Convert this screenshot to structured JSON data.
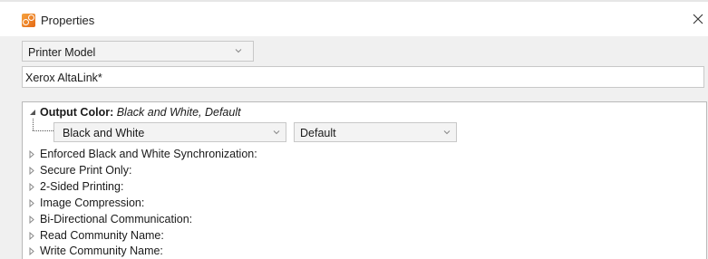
{
  "window": {
    "title": "Properties"
  },
  "selector": {
    "value": "Printer Model"
  },
  "model_field": {
    "value": "Xerox AltaLink*"
  },
  "output_color": {
    "label": "Output Color:",
    "current": "Black and White, Default",
    "color_value": "Black and White",
    "mode_value": "Default"
  },
  "properties": [
    "Enforced Black and White Synchronization:",
    "Secure Print Only:",
    "2-Sided Printing:",
    "Image Compression:",
    "Bi-Directional Communication:",
    "Read Community Name:",
    "Write Community Name:"
  ],
  "icons": {
    "app": "properties-icon",
    "close": "close-icon",
    "dropdown": "chevron-down-icon",
    "expanded": "expanded-triangle-icon",
    "collapsed": "collapsed-triangle-icon"
  },
  "colors": {
    "app_icon": "#e56a16",
    "background": "#f0f0f0",
    "panel": "#ffffff"
  }
}
